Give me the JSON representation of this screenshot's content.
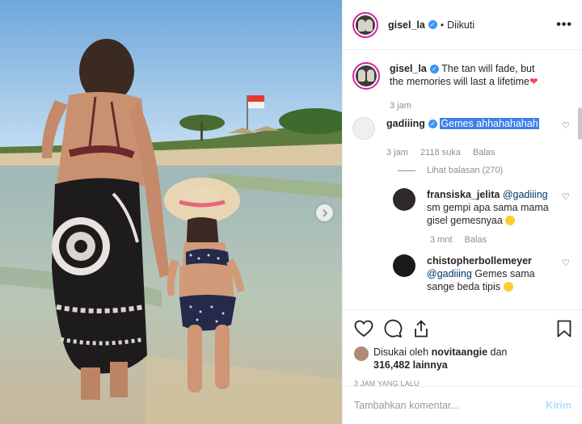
{
  "header": {
    "username": "gisel_la",
    "verified_mark": "✓",
    "separator": "•",
    "follow_status": "Diikuti",
    "more_label": "•••"
  },
  "caption": {
    "username": "gisel_la",
    "text": "The tan will fade, but the memories will last a lifetime",
    "emoji": "❤",
    "time": "3 jam"
  },
  "comments": [
    {
      "username": "gadiiing",
      "text": "Gemes ahhahahahah",
      "time": "3 jam",
      "likes": "2118 suka",
      "reply_label": "Balas",
      "view_replies": "Lihat balasan (270)"
    }
  ],
  "replies": [
    {
      "username": "fransiska_jelita",
      "mention": "@gadiiing",
      "text": "sm gempi apa sama mama gisel gemesnyaa",
      "time": "3 mnt",
      "reply_label": "Balas"
    },
    {
      "username": "chistopherbollemeyer",
      "mention": "@gadiiing",
      "text": "Gemes sama sange beda tipis"
    }
  ],
  "likes": {
    "prefix": "Disukai oleh",
    "user": "novitaangie",
    "joiner": "dan",
    "count": "316,482 lainnya"
  },
  "timestamp": "3 JAM YANG LALU",
  "add_comment": {
    "placeholder": "Tambahkan komentar...",
    "post_label": "Kirim"
  },
  "colors": {
    "verified": "#3897f0",
    "highlight": "#3f7fe8",
    "heart": "#ed4956",
    "post_disabled": "#b2dffc"
  },
  "icons": [
    "heart-icon",
    "comment-icon",
    "share-icon",
    "bookmark-icon",
    "chevron-right-icon",
    "more-icon"
  ]
}
